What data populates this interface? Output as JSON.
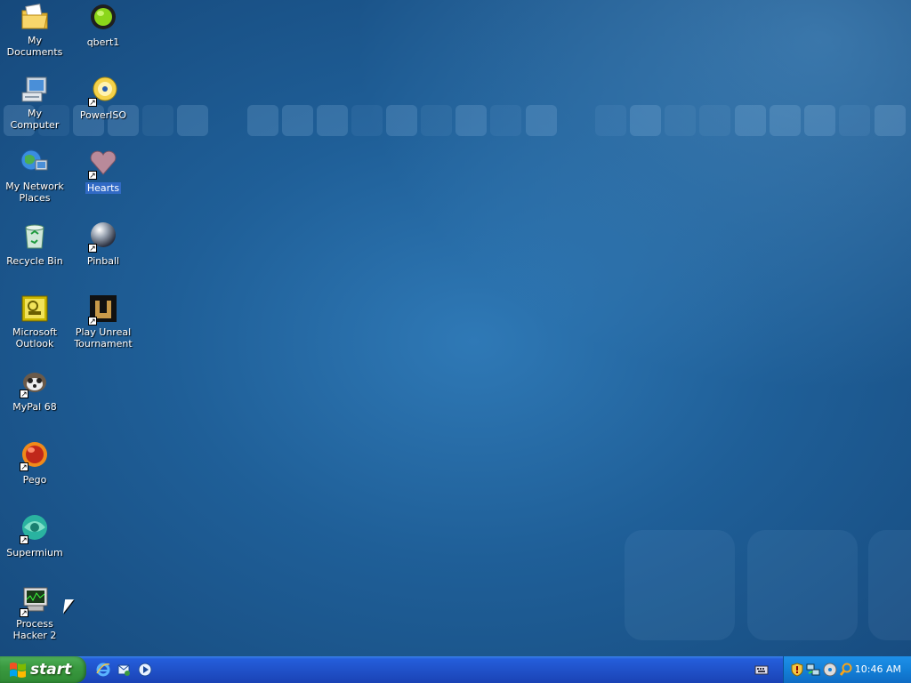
{
  "desktop": {
    "icons": [
      {
        "label": "My Documents",
        "icon": "folder-icon"
      },
      {
        "label": "qbert1",
        "icon": "qbert-icon"
      },
      {
        "label": "My Computer",
        "icon": "computer-icon"
      },
      {
        "label": "PowerISO",
        "icon": "disc-icon"
      },
      {
        "label": "My Network Places",
        "icon": "network-icon"
      },
      {
        "label": "Hearts",
        "icon": "heart-icon",
        "selected": true
      },
      {
        "label": "Recycle Bin",
        "icon": "recycle-bin-icon"
      },
      {
        "label": "Pinball",
        "icon": "pinball-icon"
      },
      {
        "label": "Microsoft Outlook",
        "icon": "outlook-icon"
      },
      {
        "label": "Play Unreal Tournament",
        "icon": "unreal-icon"
      },
      {
        "label": "MyPal 68",
        "icon": "mypal-icon"
      },
      {
        "label": "Pego",
        "icon": "pego-icon"
      },
      {
        "label": "Supermium",
        "icon": "supermium-icon"
      },
      {
        "label": "Process Hacker 2",
        "icon": "process-hacker-icon"
      }
    ]
  },
  "taskbar": {
    "start_label": "start",
    "quick_launch": [
      "internet-explorer-icon",
      "outlook-express-icon",
      "media-player-icon"
    ],
    "tray_icons": [
      "keyboard-icon",
      "security-shield-icon",
      "network-icon",
      "cd-icon",
      "search-icon"
    ],
    "clock": "10:46 AM"
  },
  "colors": {
    "desktop_blue": "#1f5f98",
    "taskbar_blue": "#245edb",
    "start_green": "#3a9a40",
    "tray_blue": "#1380d8",
    "selection_blue": "#316ac5"
  }
}
